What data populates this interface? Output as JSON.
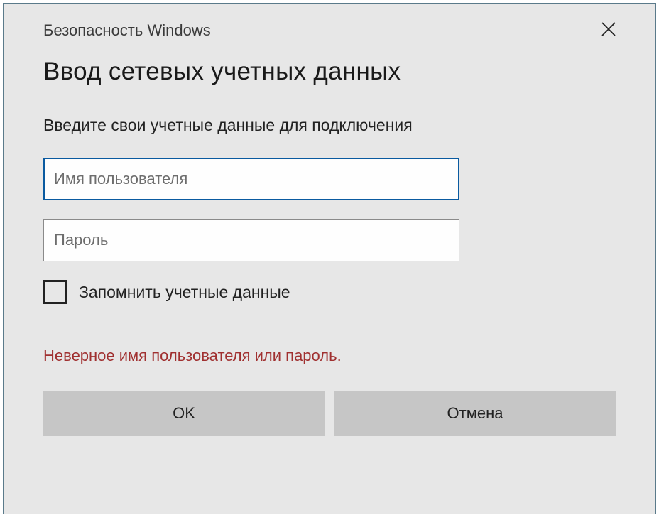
{
  "titlebar": {
    "title": "Безопасность Windows"
  },
  "dialog": {
    "heading": "Ввод сетевых учетных данных",
    "instruction": "Введите свои учетные данные для подключения",
    "username": {
      "placeholder": "Имя пользователя",
      "value": ""
    },
    "password": {
      "placeholder": "Пароль",
      "value": ""
    },
    "remember_label": "Запомнить учетные данные",
    "error_message": "Неверное имя пользователя или пароль.",
    "ok_label": "OK",
    "cancel_label": "Отмена"
  }
}
